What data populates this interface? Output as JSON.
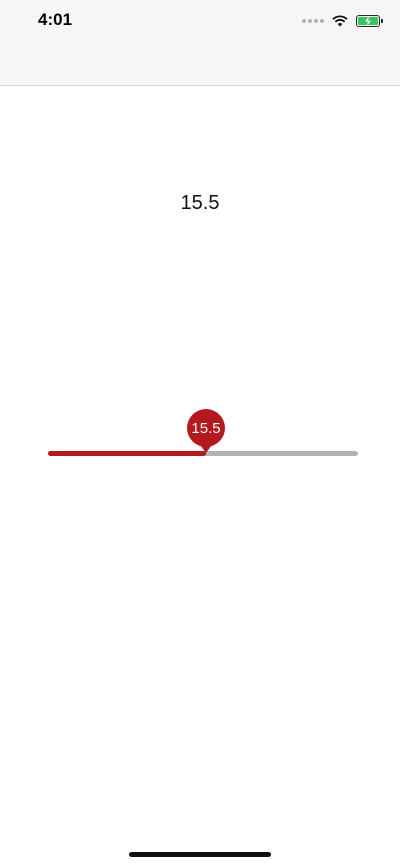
{
  "status_bar": {
    "time": "4:01",
    "icons": [
      "cellular-signal-icon",
      "wifi-icon",
      "battery-charging-icon"
    ],
    "battery_color": "#34c759"
  },
  "main": {
    "value_text": "15.5"
  },
  "slider": {
    "value": 15.5,
    "value_label": "15.5",
    "fill_fraction": 0.51,
    "accent_color": "#b3191f",
    "track_color": "#b3b3b3"
  }
}
